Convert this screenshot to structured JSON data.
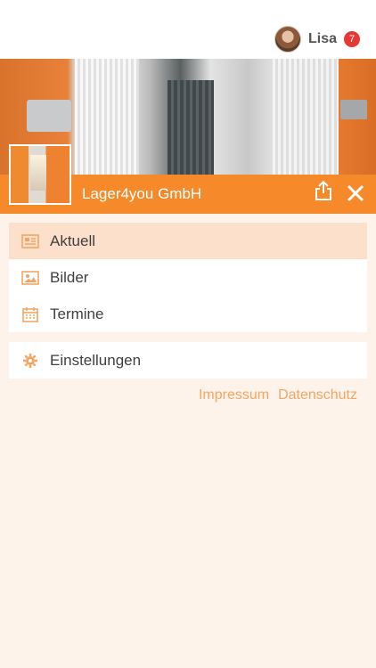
{
  "user": {
    "name": "Lisa",
    "notifications": "7"
  },
  "company": {
    "name": "Lager4you GmbH"
  },
  "menu": {
    "items": [
      {
        "label": "Aktuell",
        "icon": "newspaper-icon",
        "active": true
      },
      {
        "label": "Bilder",
        "icon": "image-icon",
        "active": false
      },
      {
        "label": "Termine",
        "icon": "calendar-icon",
        "active": false
      }
    ],
    "settings": {
      "label": "Einstellungen",
      "icon": "gear-icon"
    }
  },
  "footer": {
    "impressum": "Impressum",
    "datenschutz": "Datenschutz"
  },
  "colors": {
    "accent": "#f6892a",
    "active_bg": "#fde0cc",
    "link": "#f3a663",
    "badge": "#e53935",
    "page_bg": "#fdf3ea"
  }
}
